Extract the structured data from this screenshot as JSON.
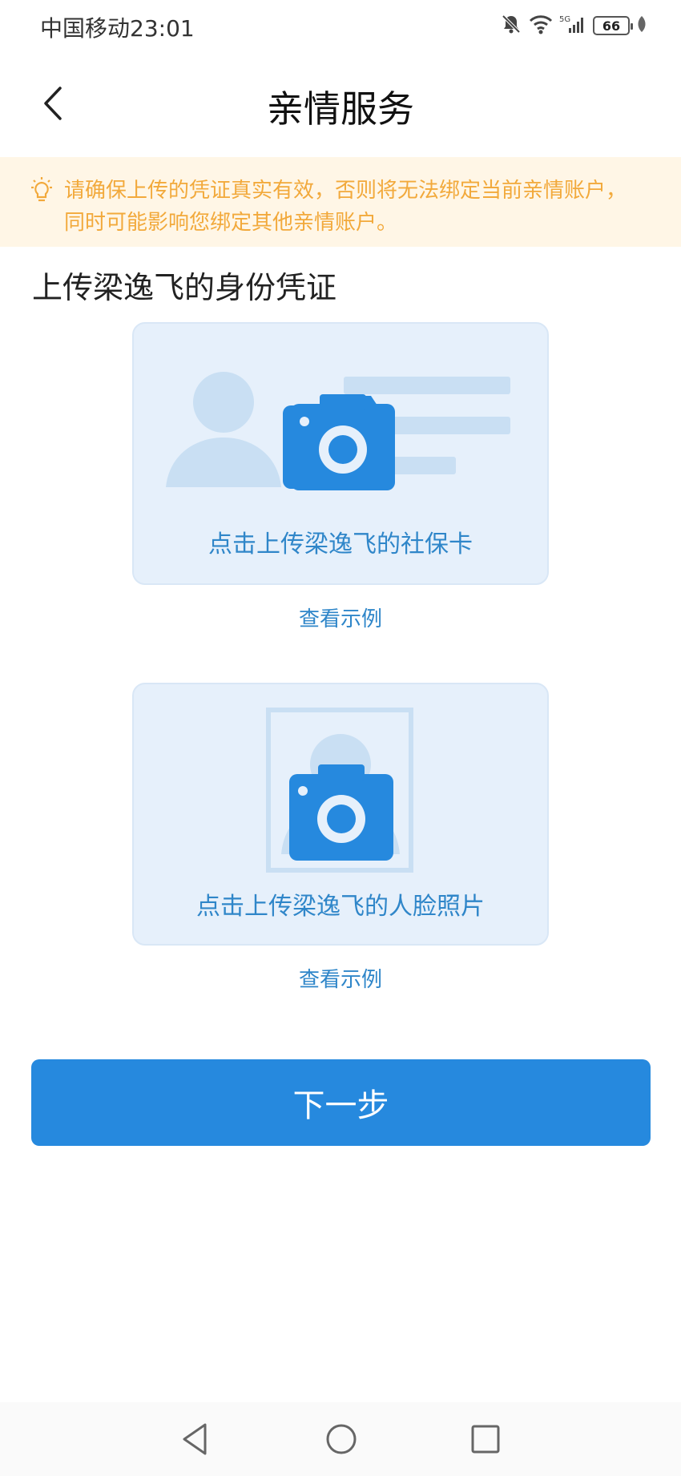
{
  "status_bar": {
    "carrier_time": "中国移动23:01",
    "network": "5G",
    "battery": "66"
  },
  "header": {
    "title": "亲情服务"
  },
  "notice": {
    "text": "请确保上传的凭证真实有效，否则将无法绑定当前亲情账户，同时可能影响您绑定其他亲情账户。"
  },
  "section": {
    "title": "上传梁逸飞的身份凭证"
  },
  "uploads": [
    {
      "label": "点击上传梁逸飞的社保卡",
      "example_link": "查看示例"
    },
    {
      "label": "点击上传梁逸飞的人脸照片",
      "example_link": "查看示例"
    }
  ],
  "actions": {
    "next": "下一步"
  },
  "colors": {
    "accent": "#2689de",
    "link": "#2f86c9",
    "notice_bg": "#fff6e6",
    "notice_text": "#f2a93b",
    "card_bg": "#e6f0fb"
  }
}
